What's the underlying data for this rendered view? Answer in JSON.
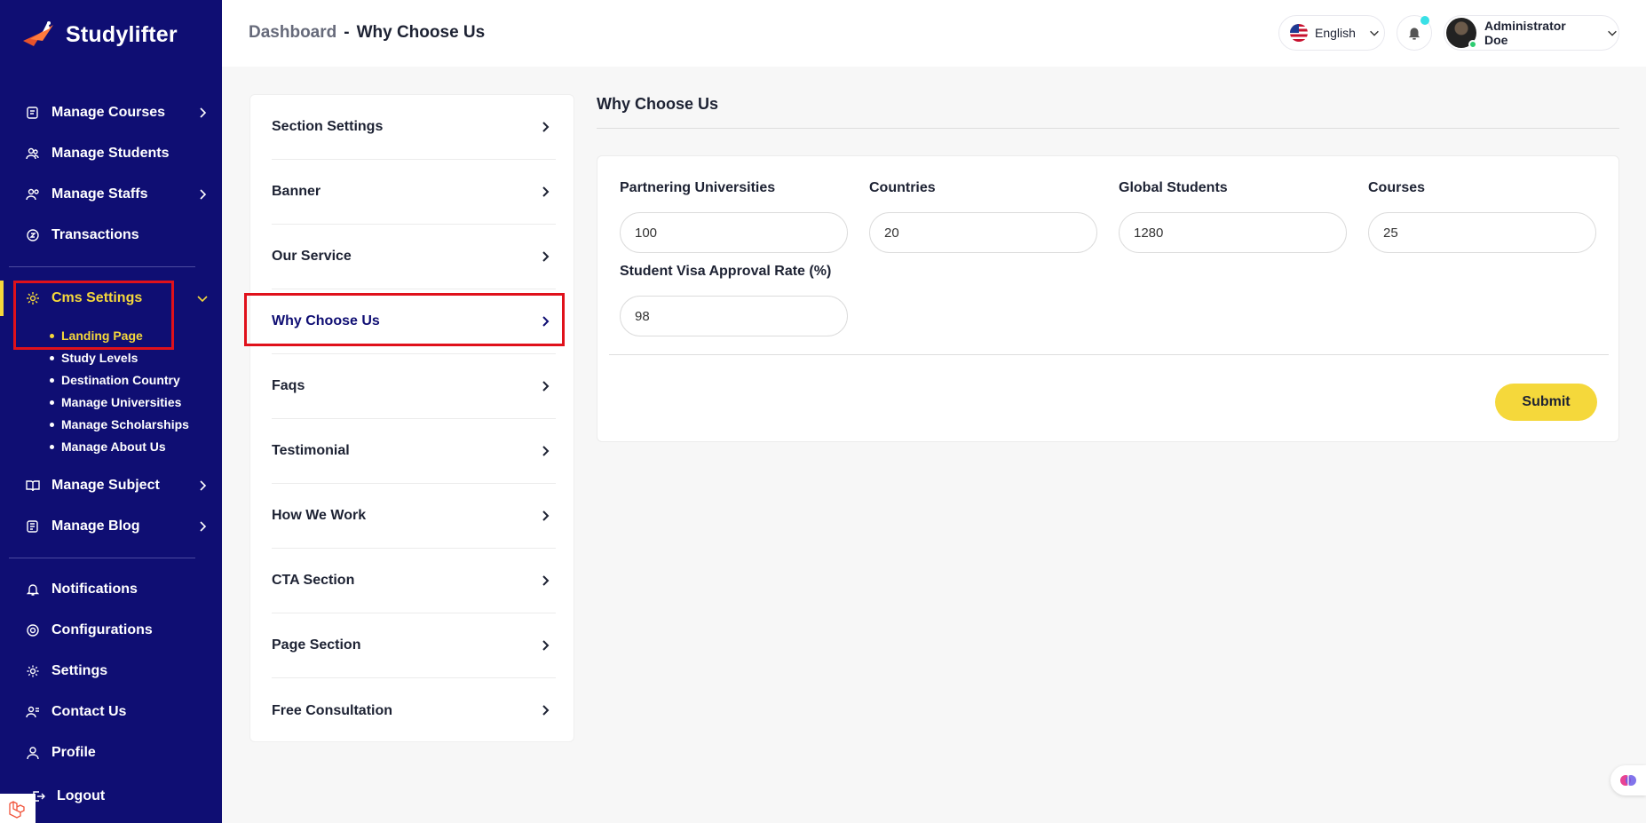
{
  "brand": {
    "name": "Studylifter"
  },
  "sidebar": {
    "items": [
      {
        "label": "Manage Courses",
        "icon": "courses-icon",
        "has_chevron": true
      },
      {
        "label": "Manage Students",
        "icon": "students-icon",
        "has_chevron": false
      },
      {
        "label": "Manage Staffs",
        "icon": "staffs-icon",
        "has_chevron": true
      },
      {
        "label": "Transactions",
        "icon": "transactions-icon",
        "has_chevron": false
      },
      {
        "label": "Cms Settings",
        "icon": "cms-icon",
        "has_chevron": true,
        "expanded": true,
        "active": true
      },
      {
        "label": "Manage Subject",
        "icon": "subject-icon",
        "has_chevron": true
      },
      {
        "label": "Manage Blog",
        "icon": "blog-icon",
        "has_chevron": true
      },
      {
        "label": "Notifications",
        "icon": "bell-icon",
        "has_chevron": false
      },
      {
        "label": "Configurations",
        "icon": "configurations-icon",
        "has_chevron": false
      },
      {
        "label": "Settings",
        "icon": "gear-icon",
        "has_chevron": false
      },
      {
        "label": "Contact Us",
        "icon": "contact-icon",
        "has_chevron": false
      },
      {
        "label": "Profile",
        "icon": "user-icon",
        "has_chevron": false
      },
      {
        "label": "Logout",
        "icon": "logout-icon",
        "has_chevron": false
      }
    ],
    "cms_subitems": [
      {
        "label": "Landing Page",
        "active": true
      },
      {
        "label": "Study Levels"
      },
      {
        "label": "Destination Country"
      },
      {
        "label": "Manage Universities"
      },
      {
        "label": "Manage Scholarships"
      },
      {
        "label": "Manage About Us"
      }
    ]
  },
  "header": {
    "breadcrumb_root": "Dashboard",
    "breadcrumb_sep": "-",
    "breadcrumb_current": "Why Choose Us",
    "language": "English",
    "user_name": "Administrator Doe"
  },
  "section_menu": [
    {
      "label": "Section Settings"
    },
    {
      "label": "Banner"
    },
    {
      "label": "Our Service"
    },
    {
      "label": "Why Choose Us",
      "selected": true
    },
    {
      "label": "Faqs"
    },
    {
      "label": "Testimonial"
    },
    {
      "label": "How We Work"
    },
    {
      "label": "CTA Section"
    },
    {
      "label": "Page Section"
    },
    {
      "label": "Free Consultation"
    }
  ],
  "main": {
    "title": "Why Choose Us",
    "fields": [
      {
        "label": "Partnering Universities",
        "value": "100"
      },
      {
        "label": "Countries",
        "value": "20"
      },
      {
        "label": "Global Students",
        "value": "1280"
      },
      {
        "label": "Courses",
        "value": "25"
      },
      {
        "label": "Student Visa Approval Rate (%)",
        "value": "98"
      }
    ],
    "submit_label": "Submit"
  },
  "colors": {
    "sidebar_bg": "#0f0e73",
    "accent_yellow": "#f5d83b",
    "highlight_red": "#e0111b"
  }
}
